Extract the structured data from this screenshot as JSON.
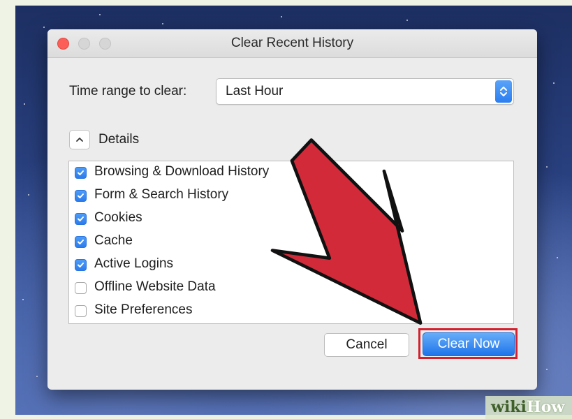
{
  "dialog": {
    "title": "Clear Recent History",
    "time_range_label": "Time range to clear:",
    "time_range_value": "Last Hour",
    "details_label": "Details",
    "items": [
      {
        "label": "Browsing & Download History",
        "checked": true
      },
      {
        "label": "Form & Search History",
        "checked": true
      },
      {
        "label": "Cookies",
        "checked": true
      },
      {
        "label": "Cache",
        "checked": true
      },
      {
        "label": "Active Logins",
        "checked": true
      },
      {
        "label": "Offline Website Data",
        "checked": false
      },
      {
        "label": "Site Preferences",
        "checked": false
      }
    ],
    "cancel_label": "Cancel",
    "clear_label": "Clear Now"
  },
  "watermark": {
    "part1": "wiki",
    "part2": "How"
  },
  "colors": {
    "accent_blue": "#2a7ef0",
    "annotation_red": "#d3202e",
    "close_red": "#fc5f57"
  },
  "icons": {
    "window_close": "close-dot-icon",
    "stepper": "up-down-stepper-icon",
    "details_toggle": "chevron-up-icon",
    "checkbox": "checkmark-icon",
    "annotation": "red-arrow-icon"
  }
}
